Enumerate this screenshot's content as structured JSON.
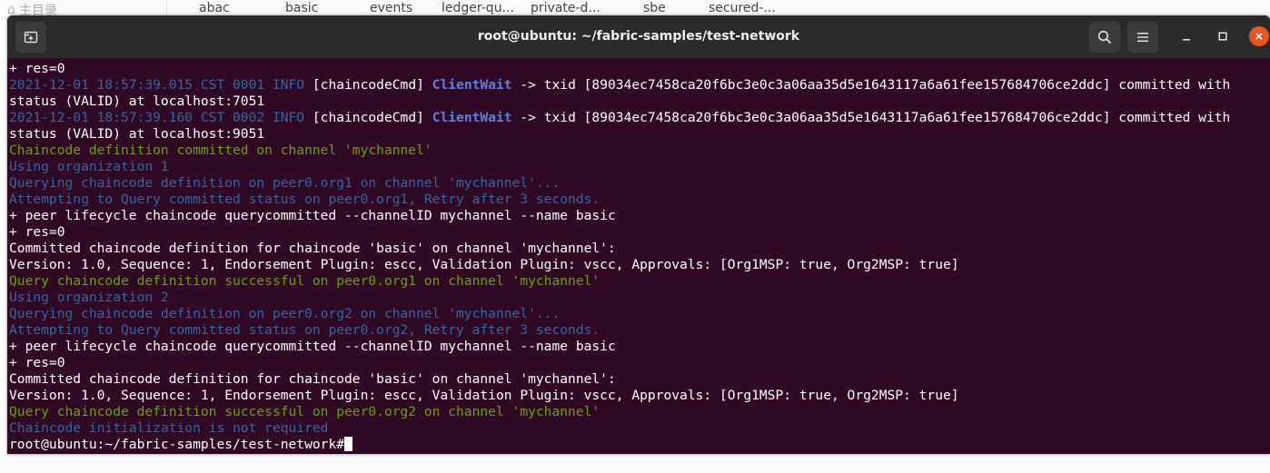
{
  "background": {
    "home_label": "主目录",
    "files": [
      "abac",
      "basic",
      "events",
      "ledger-qu...",
      "private-d...",
      "sbe",
      "secured-..."
    ]
  },
  "window": {
    "title": "root@ubuntu: ~/fabric-samples/test-network",
    "icons": {
      "new_tab": "new-tab-icon",
      "search": "search-icon",
      "menu": "hamburger-menu-icon",
      "minimize": "minimize-icon",
      "maximize": "maximize-icon",
      "close": "close-icon"
    }
  },
  "colors": {
    "terminal_bg": "#300a24",
    "titlebar_bg": "#2b2b2b",
    "info_blue": "#3465a4",
    "success_green": "#6aa00f",
    "close_orange": "#e95420"
  },
  "terminal": {
    "lines": [
      {
        "segments": [
          {
            "text": "+ res=0",
            "color": "default"
          }
        ]
      },
      {
        "segments": [
          {
            "text": "2021-12-01 18:57:39.015 CST 0001 INFO",
            "color": "blue"
          },
          {
            "text": " [chaincodeCmd] ",
            "color": "default"
          },
          {
            "text": "ClientWait",
            "color": "cw"
          },
          {
            "text": " -> txid [89034ec7458ca20f6bc3e0c3a06aa35d5e1643117a6a61fee157684706ce2ddc] committed with",
            "color": "default"
          }
        ]
      },
      {
        "segments": [
          {
            "text": "status (VALID) at localhost:7051",
            "color": "default"
          }
        ]
      },
      {
        "segments": [
          {
            "text": "2021-12-01 18:57:39.160 CST 0002 INFO",
            "color": "blue"
          },
          {
            "text": " [chaincodeCmd] ",
            "color": "default"
          },
          {
            "text": "ClientWait",
            "color": "cw"
          },
          {
            "text": " -> txid [89034ec7458ca20f6bc3e0c3a06aa35d5e1643117a6a61fee157684706ce2ddc] committed with",
            "color": "default"
          }
        ]
      },
      {
        "segments": [
          {
            "text": "status (VALID) at localhost:9051",
            "color": "default"
          }
        ]
      },
      {
        "segments": [
          {
            "text": "Chaincode definition committed on channel 'mychannel'",
            "color": "green"
          }
        ]
      },
      {
        "segments": [
          {
            "text": "Using organization 1",
            "color": "blue"
          }
        ]
      },
      {
        "segments": [
          {
            "text": "Querying chaincode definition on peer0.org1 on channel 'mychannel'...",
            "color": "blue"
          }
        ]
      },
      {
        "segments": [
          {
            "text": "Attempting to Query committed status on peer0.org1, Retry after 3 seconds.",
            "color": "blue"
          }
        ]
      },
      {
        "segments": [
          {
            "text": "+ peer lifecycle chaincode querycommitted --channelID mychannel --name basic",
            "color": "default"
          }
        ]
      },
      {
        "segments": [
          {
            "text": "+ res=0",
            "color": "default"
          }
        ]
      },
      {
        "segments": [
          {
            "text": "Committed chaincode definition for chaincode 'basic' on channel 'mychannel':",
            "color": "default"
          }
        ]
      },
      {
        "segments": [
          {
            "text": "Version: 1.0, Sequence: 1, Endorsement Plugin: escc, Validation Plugin: vscc, Approvals: [Org1MSP: true, Org2MSP: true]",
            "color": "default"
          }
        ]
      },
      {
        "segments": [
          {
            "text": "Query chaincode definition successful on peer0.org1 on channel 'mychannel'",
            "color": "green"
          }
        ]
      },
      {
        "segments": [
          {
            "text": "Using organization 2",
            "color": "blue"
          }
        ]
      },
      {
        "segments": [
          {
            "text": "Querying chaincode definition on peer0.org2 on channel 'mychannel'...",
            "color": "blue"
          }
        ]
      },
      {
        "segments": [
          {
            "text": "Attempting to Query committed status on peer0.org2, Retry after 3 seconds.",
            "color": "blue"
          }
        ]
      },
      {
        "segments": [
          {
            "text": "+ peer lifecycle chaincode querycommitted --channelID mychannel --name basic",
            "color": "default"
          }
        ]
      },
      {
        "segments": [
          {
            "text": "+ res=0",
            "color": "default"
          }
        ]
      },
      {
        "segments": [
          {
            "text": "Committed chaincode definition for chaincode 'basic' on channel 'mychannel':",
            "color": "default"
          }
        ]
      },
      {
        "segments": [
          {
            "text": "Version: 1.0, Sequence: 1, Endorsement Plugin: escc, Validation Plugin: vscc, Approvals: [Org1MSP: true, Org2MSP: true]",
            "color": "default"
          }
        ]
      },
      {
        "segments": [
          {
            "text": "Query chaincode definition successful on peer0.org2 on channel 'mychannel'",
            "color": "green"
          }
        ]
      },
      {
        "segments": [
          {
            "text": "Chaincode initialization is not required",
            "color": "blue"
          }
        ]
      }
    ],
    "prompt": "root@ubuntu:~/fabric-samples/test-network#"
  }
}
